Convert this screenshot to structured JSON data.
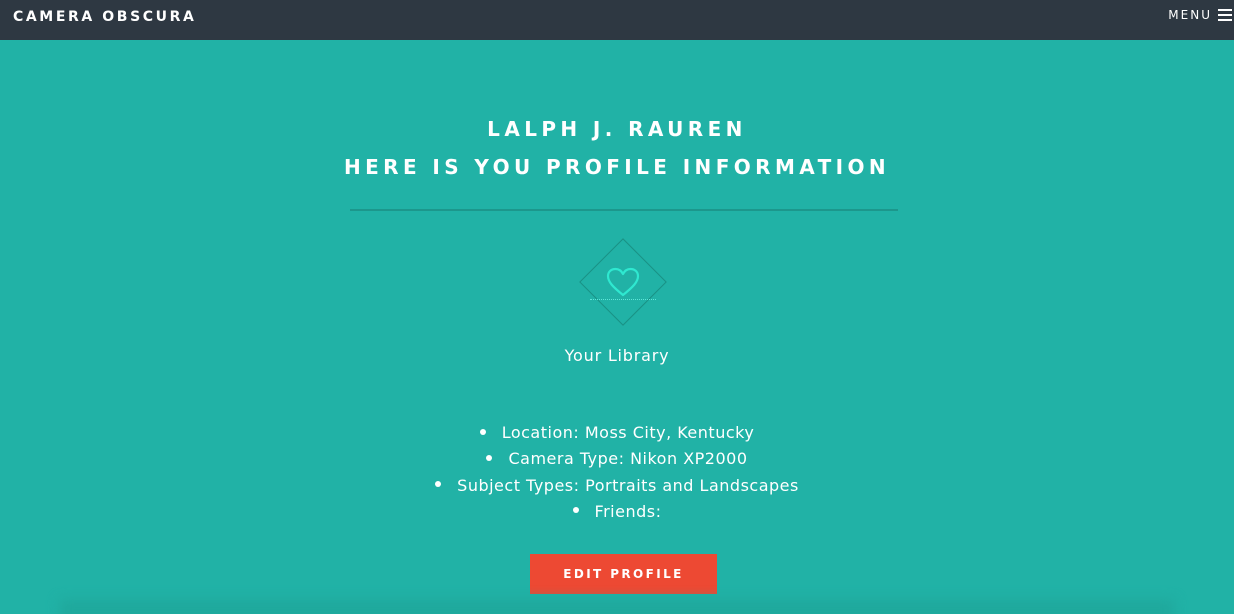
{
  "header": {
    "brand": "CAMERA OBSCURA",
    "menu_label": "MENU",
    "menu_icon": "hamburger-icon"
  },
  "hero": {
    "title_line1": "LALPH J. RAUREN",
    "title_line2": "HERE IS YOU PROFILE INFORMATION"
  },
  "library": {
    "icon": "heart-icon",
    "label": "Your Library"
  },
  "profile": {
    "items": [
      {
        "label": "Location: Moss City, Kentucky"
      },
      {
        "label": "Camera Type: Nikon XP2000"
      },
      {
        "label": "Subject Types: Portraits and Landscapes"
      },
      {
        "label": "Friends:"
      }
    ]
  },
  "actions": {
    "edit_label": "EDIT PROFILE"
  },
  "colors": {
    "background": "#21b2a6",
    "header": "#2e3842",
    "button": "#ed4933",
    "heart": "#2fe8d0"
  }
}
